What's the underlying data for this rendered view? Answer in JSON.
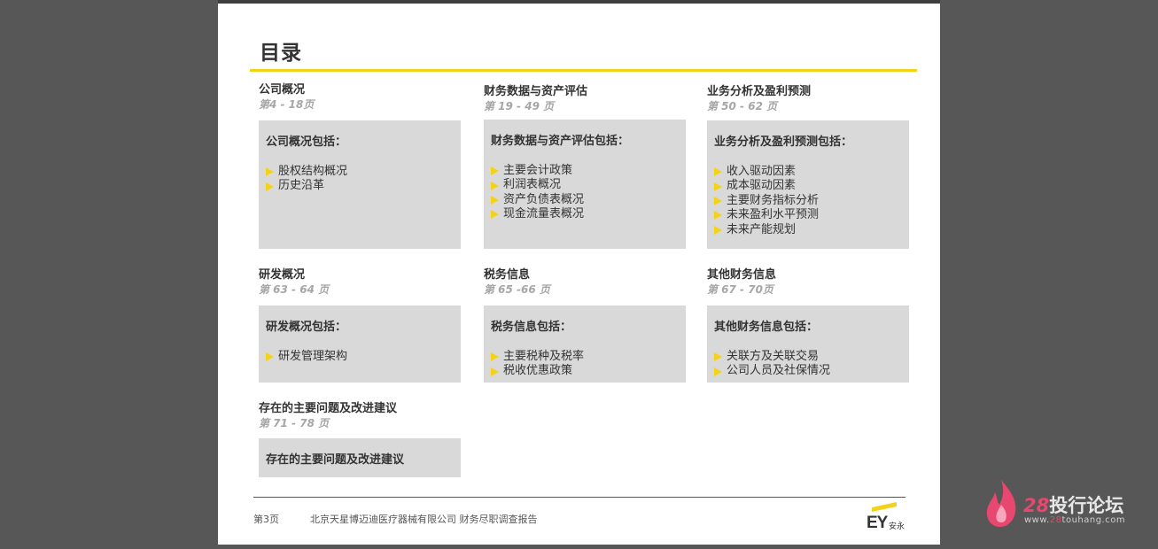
{
  "title": "目录",
  "sections": [
    {
      "heading": "公司概况",
      "pages": "第4 - 18页",
      "intro": "公司概况包括：",
      "items": [
        "股权结构概况",
        "历史沿革"
      ]
    },
    {
      "heading": "财务数据与资产评估",
      "pages": "第 19 - 49 页",
      "intro": "财务数据与资产评估包括：",
      "items": [
        "主要会计政策",
        "利润表概况",
        "资产负债表概况",
        "现金流量表概况"
      ]
    },
    {
      "heading": "业务分析及盈利预测",
      "pages": "第 50 - 62 页",
      "intro": "业务分析及盈利预测包括：",
      "items": [
        "收入驱动因素",
        "成本驱动因素",
        "主要财务指标分析",
        "未来盈利水平预测",
        "未来产能规划"
      ]
    },
    {
      "heading": "研发概况",
      "pages": "第 63 - 64 页",
      "intro": "研发概况包括：",
      "items": [
        "研发管理架构"
      ]
    },
    {
      "heading": "税务信息",
      "pages": "第 65 -66 页",
      "intro": "税务信息包括：",
      "items": [
        "主要税种及税率",
        "税收优惠政策"
      ]
    },
    {
      "heading": "其他财务信息",
      "pages": "第 67 - 70页",
      "intro": "其他财务信息包括：",
      "items": [
        "关联方及关联交易",
        "公司人员及社保情况"
      ]
    },
    {
      "heading": "存在的主要问题及改进建议",
      "pages": "第 71 - 78 页",
      "intro": "存在的主要问题及改进建议",
      "items": []
    }
  ],
  "footer": {
    "page": "第3页",
    "text": "北京天星博迈迪医疗器械有限公司 财务尽职调查报告",
    "logo_mark": "EY",
    "logo_cn": "安永"
  },
  "watermark": {
    "number": "28",
    "name": "投行论坛",
    "url_prefix": "www.",
    "url_highlight": "28",
    "url_suffix": "touhang.com"
  },
  "colors": {
    "accent": "#f5d21a",
    "box": "#d9d9d9",
    "watermark_pink": "#e8476f"
  }
}
